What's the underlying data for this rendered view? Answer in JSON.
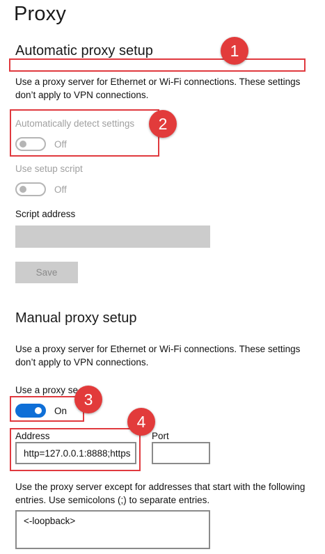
{
  "page": {
    "title": "Proxy"
  },
  "automatic": {
    "heading": "Automatic proxy setup",
    "description": "Use a proxy server for Ethernet or Wi-Fi connections. These settings don’t apply to VPN connections.",
    "auto_detect_label": "Automatically detect settings",
    "auto_detect_state": "Off",
    "setup_script_label": "Use setup script",
    "setup_script_state": "Off",
    "script_address_label": "Script address",
    "script_address_value": "",
    "save_label": "Save"
  },
  "manual": {
    "heading": "Manual proxy setup",
    "description": "Use a proxy server for Ethernet or Wi-Fi connections. These settings don’t apply to VPN connections.",
    "use_proxy_label": "Use a proxy se",
    "use_proxy_state": "On",
    "address_label": "Address",
    "address_value": "http=127.0.0.1:8888;https",
    "port_label": "Port",
    "port_value": "",
    "exceptions_description": "Use the proxy server except for addresses that start with the following entries. Use semicolons (;) to separate entries.",
    "exceptions_value": "<-loopback>"
  },
  "annotations": {
    "badge_1": "1",
    "badge_2": "2",
    "badge_3": "3",
    "badge_4": "4"
  },
  "colors": {
    "accent": "#0f6fd7",
    "annotation": "#e23b3b",
    "disabled": "#cccccc"
  }
}
